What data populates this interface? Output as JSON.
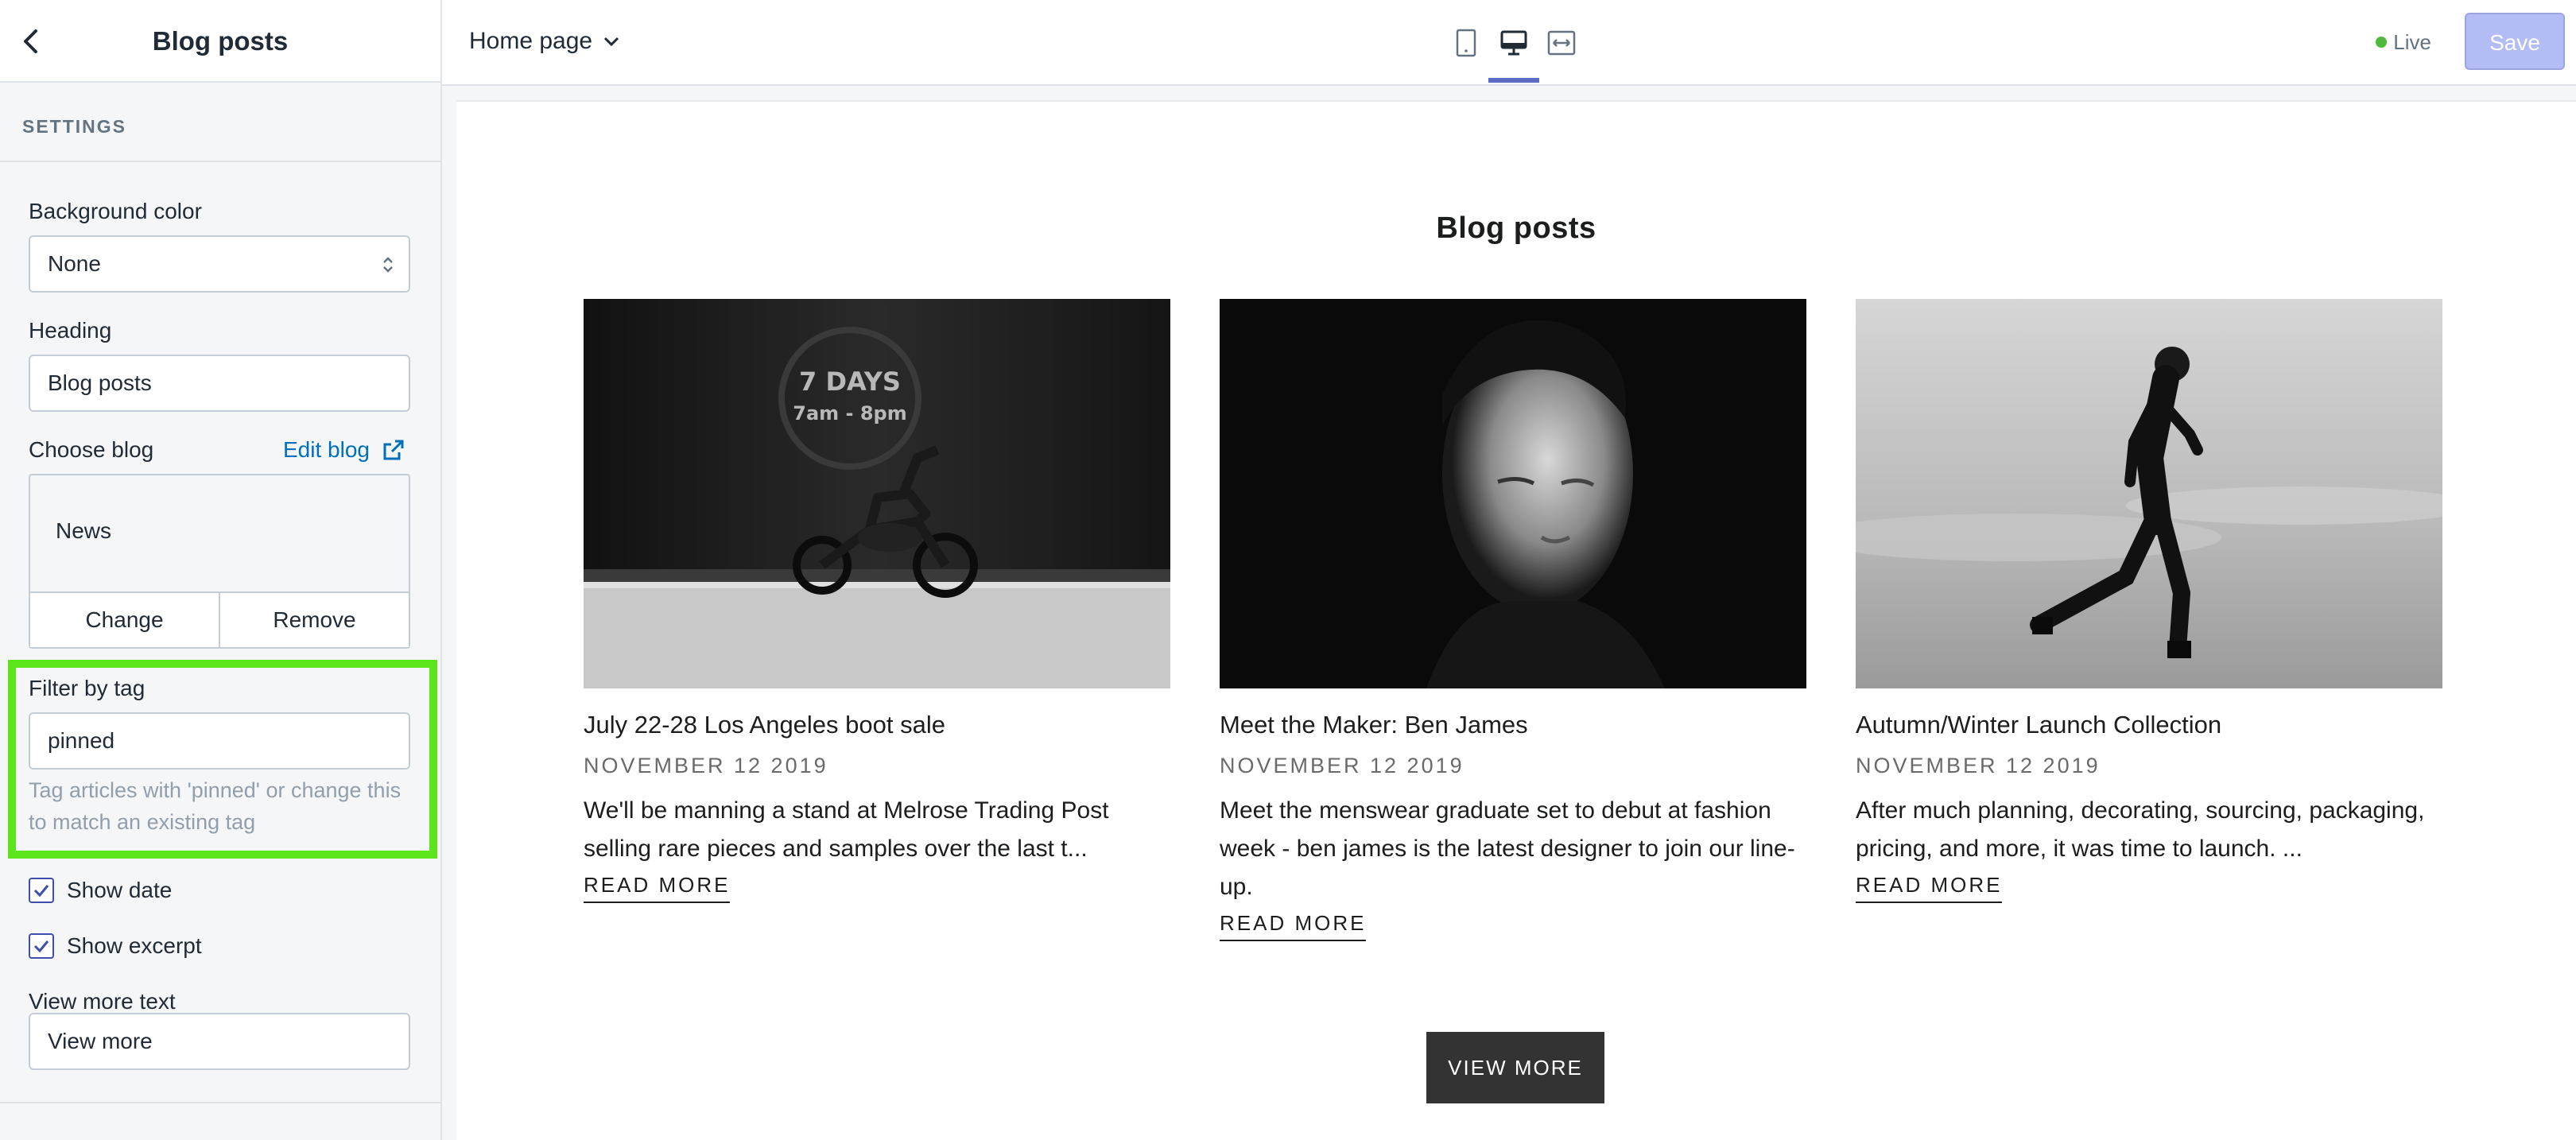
{
  "sidebar": {
    "title": "Blog posts",
    "section_label": "SETTINGS",
    "background_color": {
      "label": "Background color",
      "value": "None"
    },
    "heading": {
      "label": "Heading",
      "value": "Blog posts"
    },
    "choose_blog": {
      "label": "Choose blog",
      "edit_link": "Edit blog",
      "selected": "News",
      "change": "Change",
      "remove": "Remove"
    },
    "filter_tag": {
      "label": "Filter by tag",
      "value": "pinned",
      "help": "Tag articles with 'pinned' or change this to match an existing tag"
    },
    "show_date": {
      "label": "Show date",
      "checked": true
    },
    "show_excerpt": {
      "label": "Show excerpt",
      "checked": true
    },
    "view_more_text": {
      "label": "View more text",
      "value": "View more"
    },
    "highlight_color": "#5ce51a"
  },
  "topbar": {
    "page": "Home page",
    "status": "Live",
    "save": "Save",
    "accent": "#5c6ac4"
  },
  "preview": {
    "heading": "Blog posts",
    "posts": [
      {
        "title": "July 22-28 Los Angeles boot sale",
        "date": "NOVEMBER 12 2019",
        "excerpt": "We'll be manning a stand at Melrose Trading Post selling rare pieces and samples over the last t...",
        "read_more": "READ MORE",
        "image_text_line1": "7 DAYS",
        "image_text_line2": "7am - 8pm"
      },
      {
        "title": "Meet the Maker: Ben James",
        "date": "NOVEMBER 12 2019",
        "excerpt": "Meet the menswear graduate set to debut at fashion week - ben james is the latest designer to join our line-up.",
        "read_more": "READ MORE"
      },
      {
        "title": "Autumn/Winter Launch Collection",
        "date": "NOVEMBER 12 2019",
        "excerpt": "After much planning, decorating, sourcing, packaging, pricing, and more, it was time to launch. ...",
        "read_more": "READ MORE"
      }
    ],
    "view_more": "VIEW MORE"
  }
}
